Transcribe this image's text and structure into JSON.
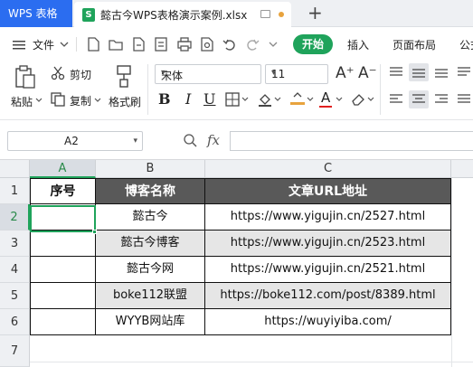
{
  "titlebar": {
    "app_tab": "WPS 表格",
    "file_tab": "懿古今WPS表格演示案例.xlsx",
    "file_badge": "S",
    "new_tab": "+"
  },
  "menu": {
    "file_label": "文件",
    "tabs": [
      {
        "label": "开始",
        "active": true
      },
      {
        "label": "插入"
      },
      {
        "label": "页面布局"
      },
      {
        "label": "公式"
      }
    ]
  },
  "toolbar": {
    "paste": "粘贴",
    "cut": "剪切",
    "copy": "复制",
    "format_painter": "格式刷",
    "font_name": "宋体",
    "font_size": "11"
  },
  "formula_bar": {
    "name_box": "A2",
    "fx": "fx",
    "content": ""
  },
  "sheet": {
    "columns": [
      "A",
      "B",
      "C"
    ],
    "rows": [
      "1",
      "2",
      "3",
      "4",
      "5",
      "6",
      "7"
    ],
    "selected_column": "A",
    "selected_row": "2",
    "header": [
      "序号",
      "博客名称",
      "文章URL地址"
    ],
    "data": [
      [
        "",
        "懿古今",
        "https://www.yigujin.cn/2527.html"
      ],
      [
        "",
        "懿古今博客",
        "https://www.yigujin.cn/2523.html"
      ],
      [
        "",
        "懿古今网",
        "https://www.yigujin.cn/2521.html"
      ],
      [
        "",
        "boke112联盟",
        "https://boke112.com/post/8389.html"
      ],
      [
        "",
        "WYYB网站库",
        "https://wuyiyiba.com/"
      ]
    ]
  },
  "colors": {
    "accent": "#1fa35b",
    "brand": "#2b6df0",
    "header_fill": "#595959",
    "alt_row_fill": "#e6e6e6"
  }
}
